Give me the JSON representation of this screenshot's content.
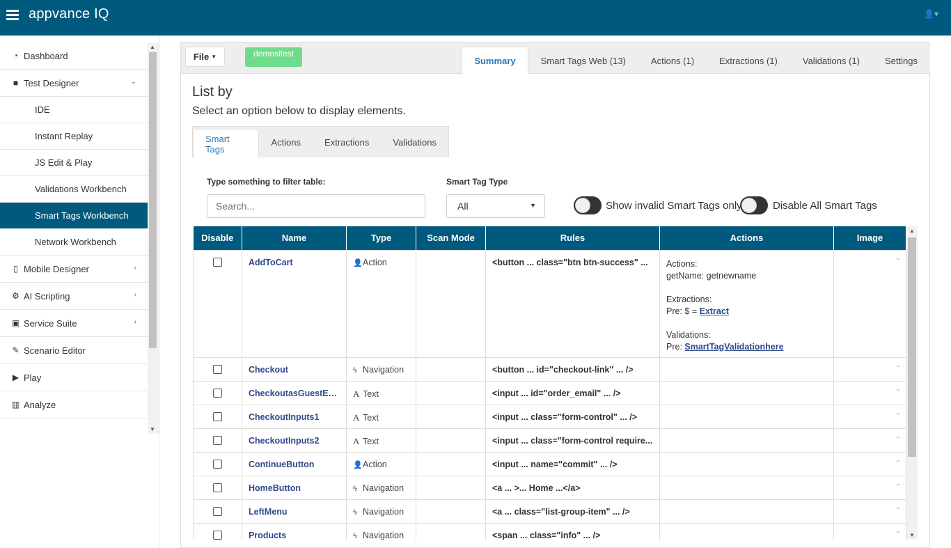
{
  "app": {
    "logo": "appvance IQ"
  },
  "sidebar": {
    "items": [
      {
        "label": "Dashboard",
        "icon": "dashboard-icon",
        "glyph": "◔"
      },
      {
        "label": "Test Designer",
        "icon": "video-camera-icon",
        "glyph": "■"
      }
    ],
    "sub_items": [
      {
        "label": "IDE"
      },
      {
        "label": "Instant Replay"
      },
      {
        "label": "JS Edit & Play"
      },
      {
        "label": "Validations Workbench"
      },
      {
        "label": "Smart Tags Workbench"
      },
      {
        "label": "Network Workbench"
      }
    ],
    "more_items": [
      {
        "label": "Mobile Designer",
        "glyph": "▯"
      },
      {
        "label": "AI Scripting",
        "glyph": "⚙"
      },
      {
        "label": "Service Suite",
        "glyph": "▣"
      },
      {
        "label": "Scenario Editor",
        "glyph": "✎"
      },
      {
        "label": "Play",
        "glyph": "▶"
      },
      {
        "label": "Analyze",
        "glyph": "▥"
      }
    ]
  },
  "header": {
    "file_label": "File",
    "env_badge": "demositest",
    "tabs": [
      {
        "label": "Summary"
      },
      {
        "label": "Smart Tags Web (13)"
      },
      {
        "label": "Actions (1)"
      },
      {
        "label": "Extractions (1)"
      },
      {
        "label": "Validations (1)"
      },
      {
        "label": "Settings"
      }
    ]
  },
  "list": {
    "title": "List by",
    "subtitle": "Select an option below to display elements.",
    "tabs": [
      {
        "label": "Smart Tags"
      },
      {
        "label": "Actions"
      },
      {
        "label": "Extractions"
      },
      {
        "label": "Validations"
      }
    ]
  },
  "filter": {
    "label": "Type something to filter table:",
    "placeholder": "Search...",
    "type_label": "Smart Tag Type",
    "type_value": "All",
    "toggle_invalid": "Show invalid Smart Tags only",
    "toggle_disable": "Disable All Smart Tags"
  },
  "table": {
    "headers": [
      "Disable",
      "Name",
      "Type",
      "Scan Mode",
      "Rules",
      "Actions",
      "Image"
    ],
    "rows": [
      {
        "name": "AddToCart",
        "type": "Action",
        "rule": "<button ... class=\"btn btn-success\" ...",
        "expanded": true
      },
      {
        "name": "Checkout",
        "type": "Navigation",
        "rule": "<button ... id=\"checkout-link\" ... />"
      },
      {
        "name": "CheckoutasGuestEm...",
        "type": "Text",
        "rule": "<input ... id=\"order_email\" ... />"
      },
      {
        "name": "CheckoutInputs1",
        "type": "Text",
        "rule": "<input ... class=\"form-control\" ... />"
      },
      {
        "name": "CheckoutInputs2",
        "type": "Text",
        "rule": "<input ... class=\"form-control require..."
      },
      {
        "name": "ContinueButton",
        "type": "Action",
        "rule": "<input ... name=\"commit\" ... />"
      },
      {
        "name": "HomeButton",
        "type": "Navigation",
        "rule": "<a ... >... Home ...</a>"
      },
      {
        "name": "LeftMenu",
        "type": "Navigation",
        "rule": "<a ... class=\"list-group-item\" ... />"
      },
      {
        "name": "Products",
        "type": "Navigation",
        "rule": "<span ... class=\"info\" ... />"
      }
    ],
    "actions_cell": {
      "actions_label": "Actions:",
      "actions_value": "getName: getnewname",
      "extractions_label": "Extractions:",
      "extractions_prefix": "Pre: $ = ",
      "extractions_link": "Extract",
      "validations_label": "Validations:",
      "validations_prefix": "Pre: ",
      "validations_link": "SmartTagValidationhere"
    },
    "image_marker": "\""
  }
}
